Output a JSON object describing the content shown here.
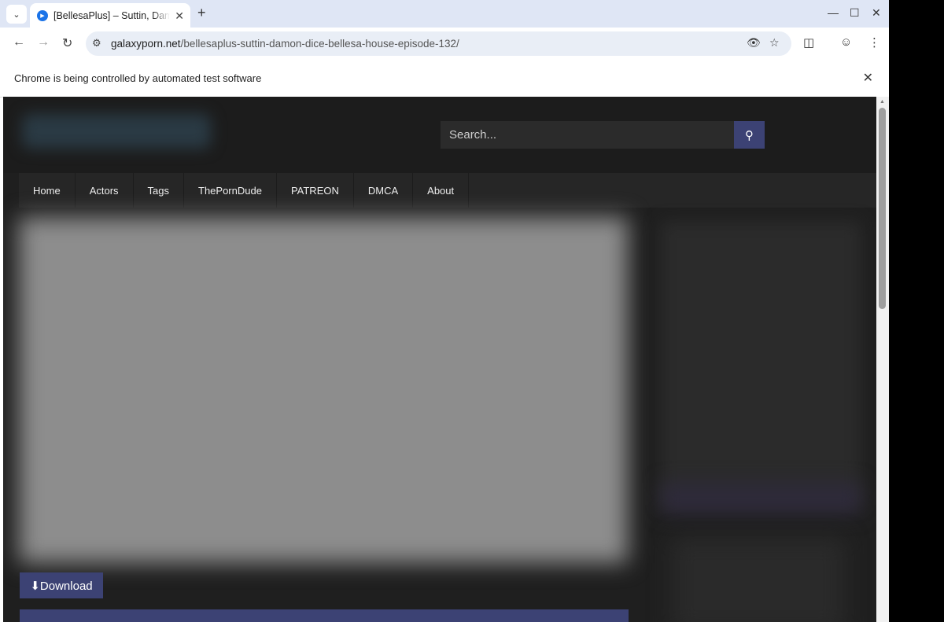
{
  "browser": {
    "tab_title": "[BellesaPlus] – Suttin, Damon Dice",
    "url_host": "galaxyporn.net",
    "url_path": "/bellesaplus-suttin-damon-dice-bellesa-house-episode-132/",
    "infobar_text": "Chrome is being controlled by automated test software"
  },
  "site": {
    "search_placeholder": "Search...",
    "nav": [
      "Home",
      "Actors",
      "Tags",
      "ThePornDude",
      "PATREON",
      "DMCA",
      "About"
    ],
    "download_label": "⬇Download"
  },
  "colors": {
    "accent": "#3c4274",
    "page_bg": "#1f1f1f",
    "header_bg": "#1c1c1c"
  }
}
